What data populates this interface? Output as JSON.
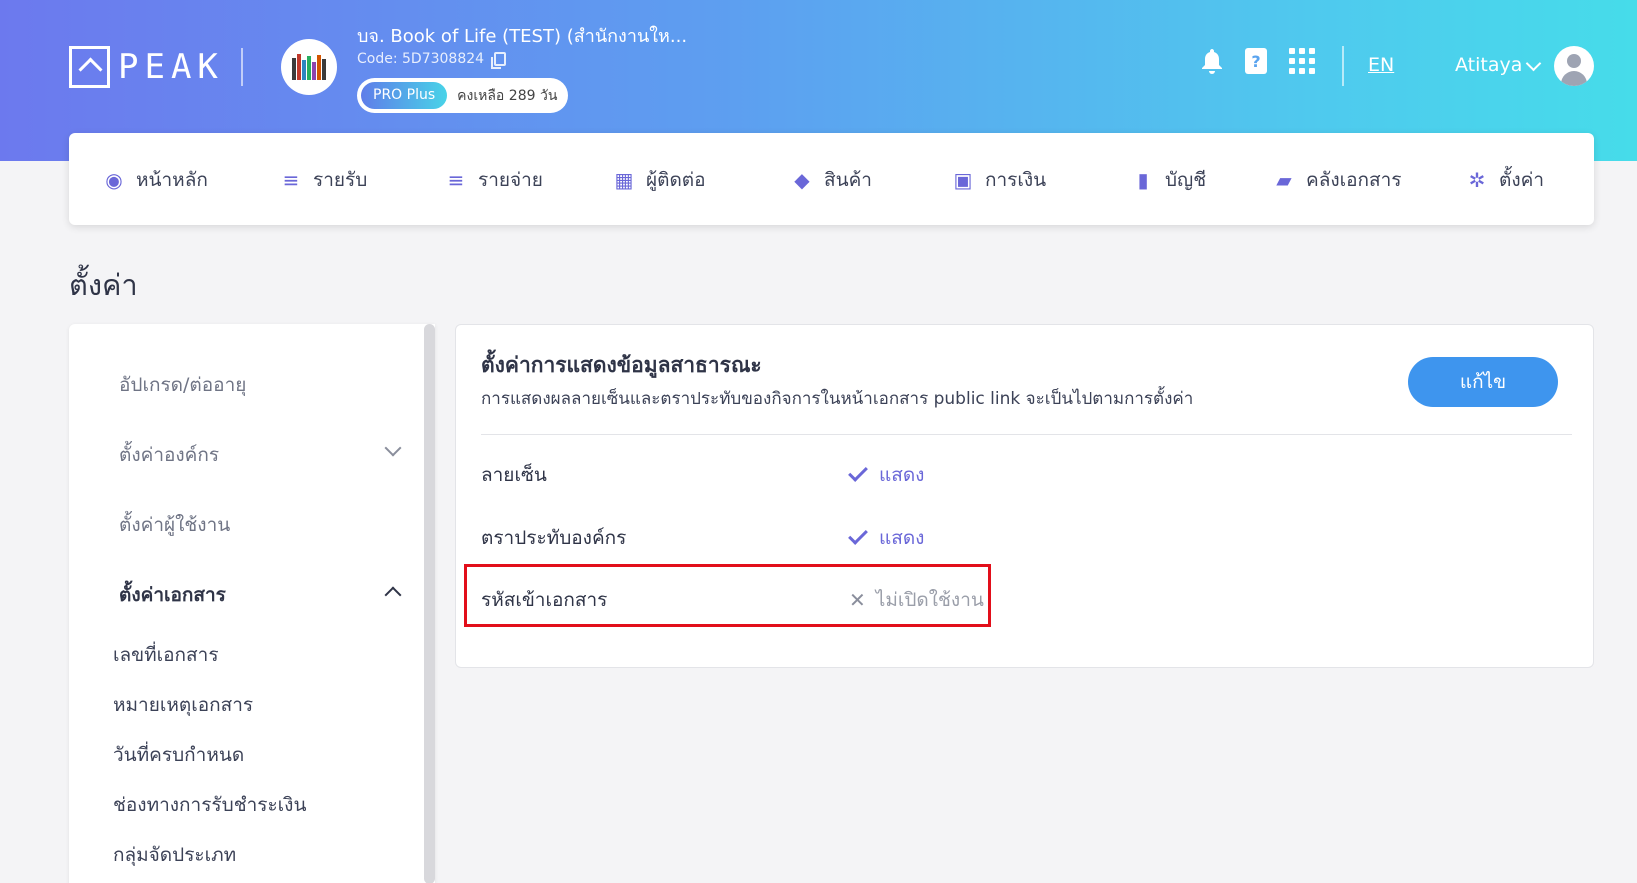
{
  "header": {
    "logo_text": "PEAK",
    "company_name": "บจ. Book of Life (TEST) (สำนักงานให...",
    "company_code": "Code: 5D7308824",
    "plan_badge": "PRO Plus",
    "plan_remaining": "คงเหลือ 289 วัน",
    "language": "EN",
    "user_name": "Atitaya",
    "help_glyph": "?",
    "colors": {
      "gradient_start": "#6c79ee",
      "gradient_end": "#46dcea"
    }
  },
  "nav": {
    "items": [
      {
        "label": "หน้าหลัก",
        "icon": "dashboard-icon",
        "glyph": "◉"
      },
      {
        "label": "รายรับ",
        "icon": "income-list-icon",
        "glyph": "≡"
      },
      {
        "label": "รายจ่าย",
        "icon": "expense-list-icon",
        "glyph": "≡"
      },
      {
        "label": "ผู้ติดต่อ",
        "icon": "building-icon",
        "glyph": "▦"
      },
      {
        "label": "สินค้า",
        "icon": "box-icon",
        "glyph": "◆"
      },
      {
        "label": "การเงิน",
        "icon": "money-icon",
        "glyph": "▣"
      },
      {
        "label": "บัญชี",
        "icon": "ledger-icon",
        "glyph": "▮"
      },
      {
        "label": "คลังเอกสาร",
        "icon": "folder-icon",
        "glyph": "▰"
      },
      {
        "label": "ตั้งค่า",
        "icon": "gear-icon",
        "glyph": "✲"
      }
    ],
    "accent": "#6a67d8"
  },
  "page": {
    "title": "ตั้งค่า"
  },
  "sidebar": {
    "items": [
      {
        "label": "อัปเกรด/ต่ออายุ"
      },
      {
        "label": "ตั้งค่าองค์กร"
      },
      {
        "label": "ตั้งค่าผู้ใช้งาน"
      },
      {
        "label": "ตั้งค่าเอกสาร"
      }
    ],
    "subitems": [
      {
        "label": "เลขที่เอกสาร"
      },
      {
        "label": "หมายเหตุเอกสาร"
      },
      {
        "label": "วันที่ครบกำหนด"
      },
      {
        "label": "ช่องทางการรับชำระเงิน"
      },
      {
        "label": "กลุ่มจัดประเภท"
      }
    ]
  },
  "card": {
    "title": "ตั้งค่าการแสดงข้อมูลสาธารณะ",
    "description": "การแสดงผลลายเซ็นและตราประทับของกิจการในหน้าเอกสาร public link จะเป็นไปตามการตั้งค่า",
    "edit_label": "แก้ไข",
    "rows": [
      {
        "label": "ลายเซ็น",
        "value": "แสดง",
        "status": "on"
      },
      {
        "label": "ตราประทับองค์กร",
        "value": "แสดง",
        "status": "on"
      },
      {
        "label": "รหัสเข้าเอกสาร",
        "value": "ไม่เปิดใช้งาน",
        "status": "off"
      }
    ],
    "x_glyph": "✕"
  }
}
